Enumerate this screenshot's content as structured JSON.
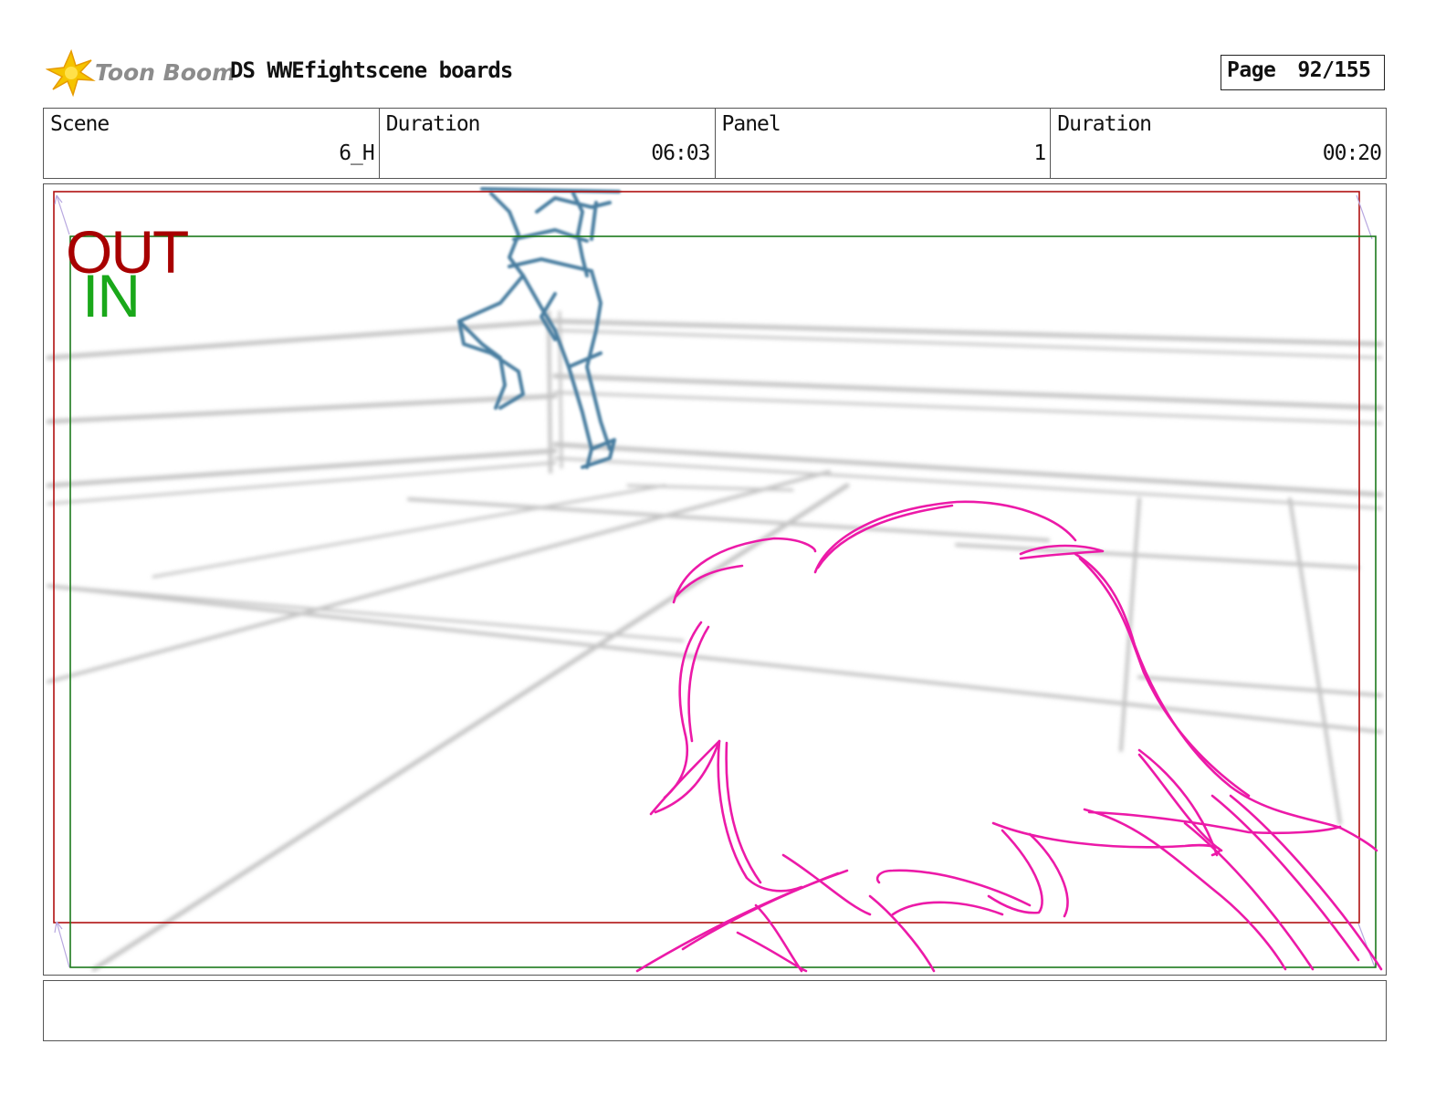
{
  "header": {
    "logo_text": "Toon Boom",
    "board_title": "DS WWEfightscene boards",
    "page_label": "Page",
    "page_value": "92/155"
  },
  "info": {
    "scene_label": "Scene",
    "scene_value": "6_H",
    "scene_duration_label": "Duration",
    "scene_duration_value": "06:03",
    "panel_label": "Panel",
    "panel_value": "1",
    "panel_duration_label": "Duration",
    "panel_duration_value": "00:20"
  },
  "panel": {
    "out_label": "OUT",
    "in_label": "IN",
    "colors": {
      "out_frame": "#b01010",
      "in_frame": "#1c7a1c",
      "out_text": "#a80000",
      "in_text": "#1aa81a",
      "sketch_magenta": "#ec1aa8",
      "sketch_blue": "#4a7ea0",
      "ring_grey": "#c4c4c4"
    }
  },
  "notes": {
    "text": ""
  }
}
